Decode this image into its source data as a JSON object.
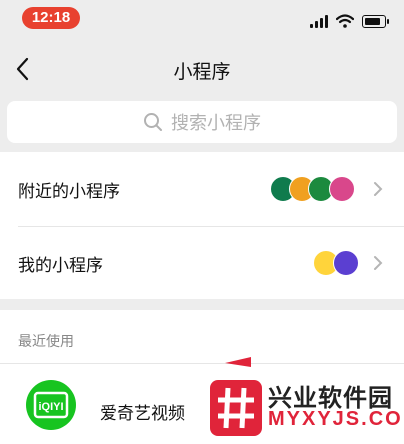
{
  "status_bar": {
    "time": "12:18"
  },
  "nav": {
    "title": "小程序"
  },
  "search": {
    "placeholder": "搜索小程序"
  },
  "menu": {
    "nearby_label": "附近的小程序",
    "mine_label": "我的小程序"
  },
  "recent": {
    "header": "最近使用",
    "items": [
      {
        "label": "爱奇艺视频"
      }
    ]
  },
  "watermark": {
    "title": "兴业软件园",
    "url": "MYXYJS.COM"
  },
  "colors": {
    "accent_green": "#17c420",
    "status_red": "#e8412f",
    "watermark_red": "#e0243a"
  }
}
